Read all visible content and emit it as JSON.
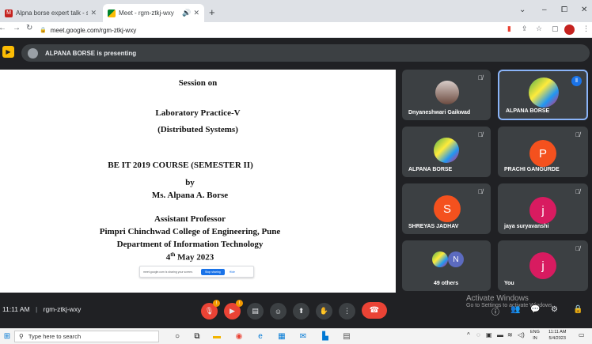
{
  "browser": {
    "tabs": [
      {
        "title": "Alpna borse expert talk - suryav...",
        "active": false
      },
      {
        "title": "Meet - rgm-ztkj-wxy",
        "active": true
      }
    ],
    "new_tab_icon": "+",
    "window_controls": {
      "minimize": "–",
      "maximize": "⧠",
      "close": "✕",
      "tab_search": "⌄"
    },
    "url": "meet.google.com/rgm-ztkj-wxy",
    "extensions_icons": [
      "translate-icon",
      "share-icon",
      "star-icon",
      "sidebar-icon",
      "profile-icon",
      "menu-icon"
    ]
  },
  "presenting": {
    "text": "ALPANA BORSE is presenting"
  },
  "slide": {
    "lines": [
      "Session on",
      "Laboratory Practice-V",
      "(Distributed Systems)",
      "BE IT 2019 COURSE (SEMESTER II)",
      "by",
      "Ms. Alpana A. Borse",
      "Assistant Professor",
      "Pimpri Chinchwad College of Engineering, Pune",
      "Department of Information Technology"
    ],
    "date_prefix": "4",
    "date_sup": "th",
    "date_suffix": " May 2023",
    "toast": {
      "text": "meet.google.com is sharing your screen.",
      "stop": "Stop sharing",
      "hide": "Hide"
    }
  },
  "participants": [
    {
      "name": "Dnyaneshwari Gaikwad",
      "avatar_type": "photo",
      "muted": true
    },
    {
      "name": "ALPANA BORSE",
      "avatar_type": "photo",
      "muted": false,
      "speaking": true
    },
    {
      "name": "ALPANA BORSE",
      "avatar_type": "photo",
      "muted": true
    },
    {
      "name": "PRACHI GANGURDE",
      "initial": "P",
      "color": "#f4511e",
      "muted": true
    },
    {
      "name": "SHREYAS JADHAV",
      "initial": "S",
      "color": "#f4511e",
      "muted": true
    },
    {
      "name": "jaya suryavanshi",
      "initial": "j",
      "color": "#d81b60",
      "muted": true
    },
    {
      "name": "49 others",
      "initial": "N",
      "color": "#5c6bc0",
      "muted": false
    },
    {
      "name": "You",
      "initial": "j",
      "color": "#d81b60",
      "muted": true
    }
  ],
  "meeting": {
    "time": "11:11 AM",
    "separator": "|",
    "code": "rgm-ztkj-wxy"
  },
  "controls": {
    "mic_badge": "!",
    "cam_badge": "!"
  },
  "watermark": {
    "line1": "Activate Windows",
    "line2": "Go to Settings to activate Windows."
  },
  "taskbar": {
    "search_placeholder": "Type here to search",
    "lang_top": "ENG",
    "lang_bottom": "IN",
    "clock_time": "11:11 AM",
    "clock_date": "5/4/2023"
  },
  "colors": {
    "accent": "#8ab4f8",
    "end_call": "#ea4335",
    "tile_bg": "#3c4043",
    "page_bg": "#202124"
  }
}
